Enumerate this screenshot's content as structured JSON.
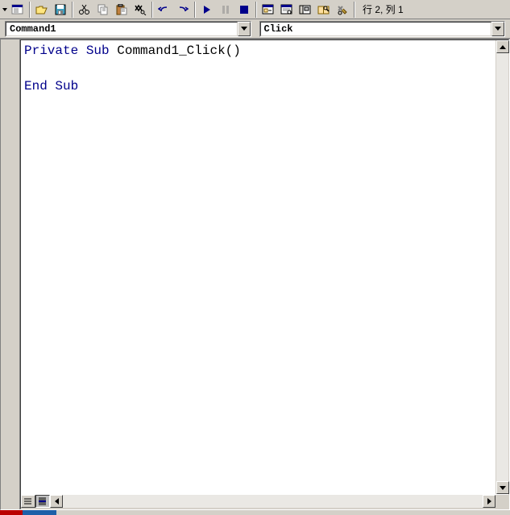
{
  "toolbar": {
    "status": "行 2, 列 1"
  },
  "dropdowns": {
    "object": "Command1",
    "procedure": "Click"
  },
  "code": {
    "line1_kw1": "Private",
    "line1_kw2": "Sub",
    "line1_ident": "Command1_Click()",
    "line3_kw": "End Sub"
  },
  "icons": {
    "dropdown": "▼"
  }
}
